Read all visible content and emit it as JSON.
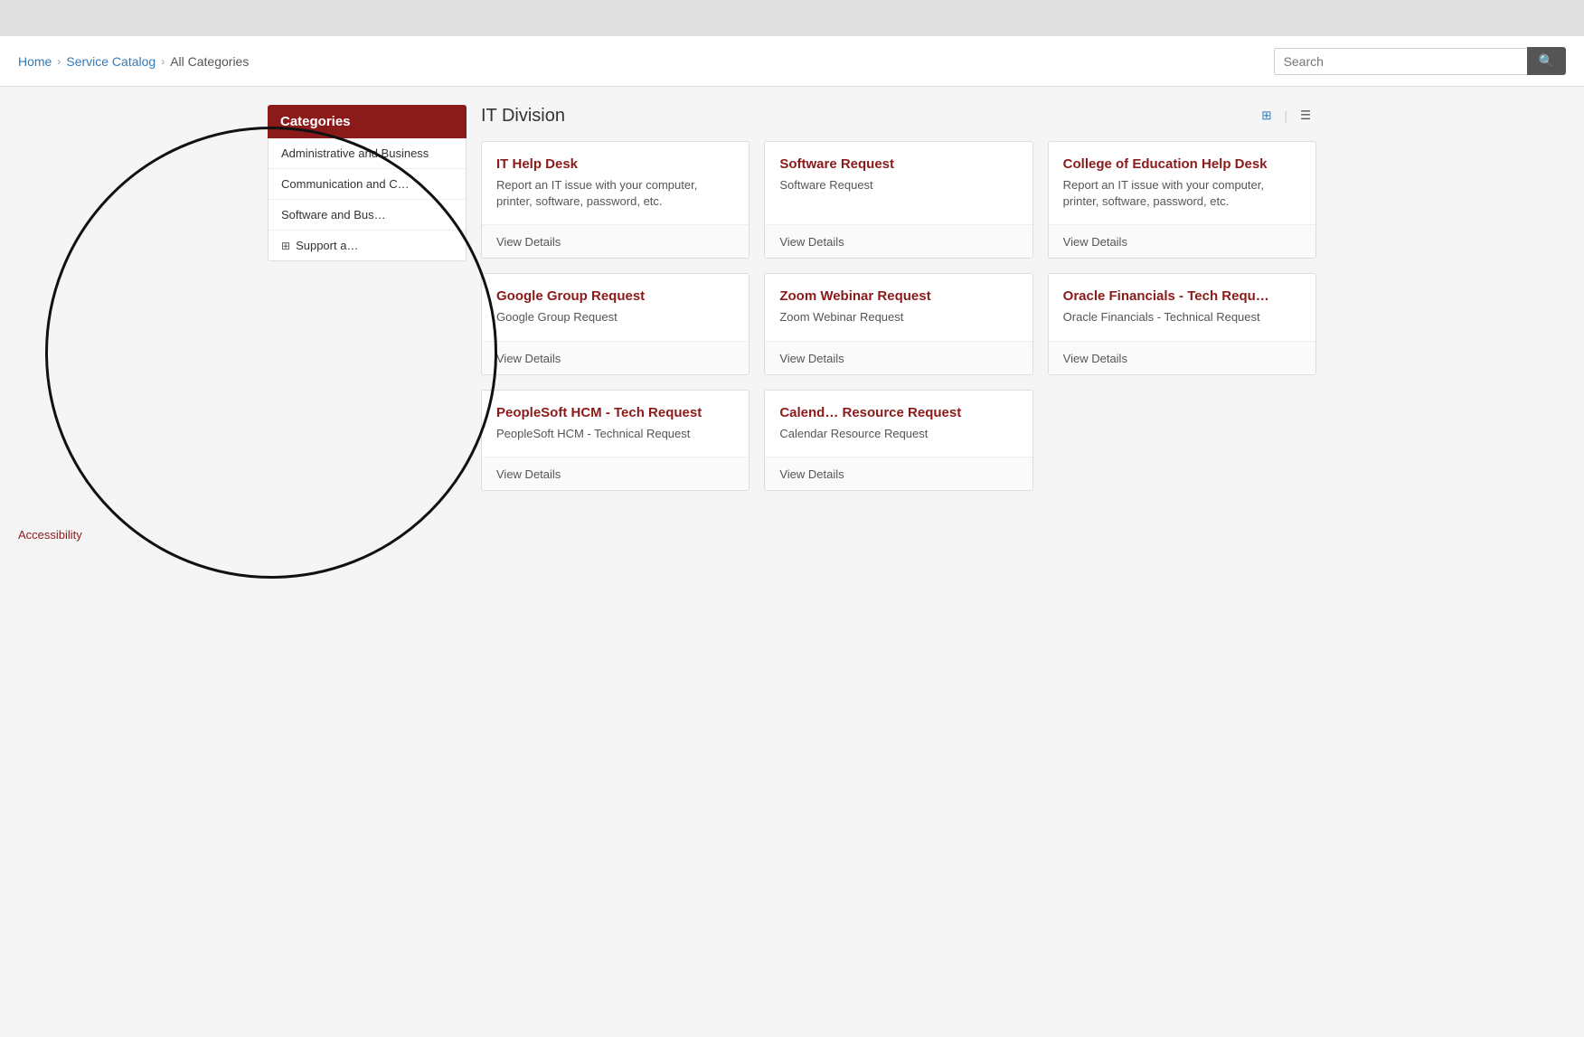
{
  "topbar": {},
  "breadcrumb": {
    "home_label": "Home",
    "service_catalog_label": "Service Catalog",
    "current_label": "All Categories"
  },
  "search": {
    "placeholder": "Search",
    "button_icon": "🔍"
  },
  "sidebar": {
    "header_label": "Categories",
    "items": [
      {
        "id": "admin-business",
        "label": "Administrative and Business",
        "has_icon": false
      },
      {
        "id": "communication",
        "label": "Communication and C…",
        "has_icon": false
      },
      {
        "id": "software-bus",
        "label": "Software and Bus…",
        "has_icon": false
      },
      {
        "id": "support",
        "label": "Support a…",
        "has_icon": true
      }
    ]
  },
  "content": {
    "title": "IT Division",
    "view_grid_icon": "⊞",
    "view_list_icon": "☰",
    "cards": [
      {
        "id": "it-help-desk",
        "title": "IT Help Desk",
        "description": "Report an IT issue with your computer, printer, software, password, etc.",
        "view_details_label": "View Details"
      },
      {
        "id": "software-request",
        "title": "Software Request",
        "description": "Software Request",
        "view_details_label": "View Details"
      },
      {
        "id": "college-of-education",
        "title": "College of Education Help Desk",
        "description": "Report an IT issue with your computer, printer, software, password, etc.",
        "view_details_label": "View Details"
      },
      {
        "id": "google-group-request",
        "title": "Google Group Request",
        "description": "Google Group Request",
        "view_details_label": "View Details"
      },
      {
        "id": "zoom-webinar-request",
        "title": "Zoom Webinar Request",
        "description": "Zoom Webinar Request",
        "view_details_label": "View Details"
      },
      {
        "id": "oracle-financials",
        "title": "Oracle Financials - Tech Requ…",
        "description": "Oracle Financials - Technical Request",
        "view_details_label": "View Details"
      },
      {
        "id": "peoplesoft-hcm",
        "title": "PeopleSoft HCM - Tech Request",
        "description": "PeopleSoft HCM - Technical Request",
        "view_details_label": "View Details"
      },
      {
        "id": "calendar-resource",
        "title": "Calend… Resource Request",
        "description": "Calendar Resource Request",
        "view_details_label": "View Details"
      }
    ]
  },
  "footer": {
    "accessibility_label": "Accessibility"
  },
  "colors": {
    "brand_red": "#8b1a1a",
    "link_blue": "#337ab7"
  }
}
